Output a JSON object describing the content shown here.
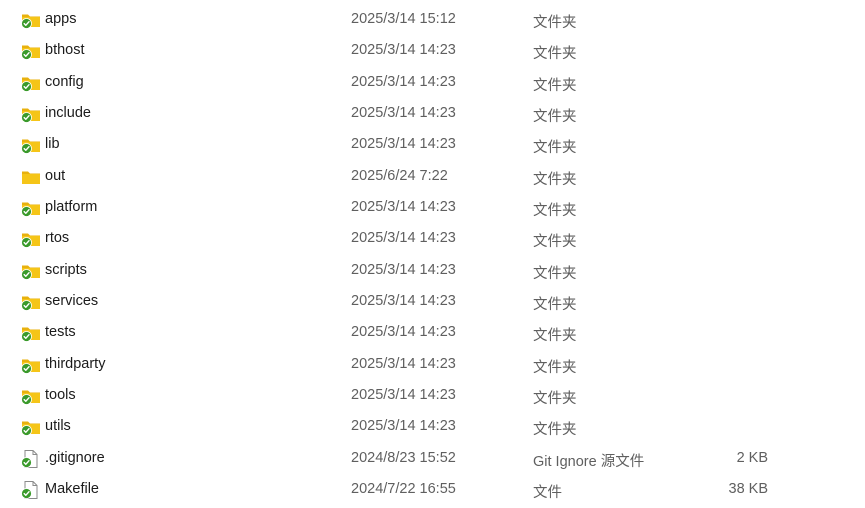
{
  "files": [
    {
      "name": "apps",
      "date": "2025/3/14 15:12",
      "type": "文件夹",
      "size": "",
      "icon": "folder-synced-icon"
    },
    {
      "name": "bthost",
      "date": "2025/3/14 14:23",
      "type": "文件夹",
      "size": "",
      "icon": "folder-synced-icon"
    },
    {
      "name": "config",
      "date": "2025/3/14 14:23",
      "type": "文件夹",
      "size": "",
      "icon": "folder-synced-icon"
    },
    {
      "name": "include",
      "date": "2025/3/14 14:23",
      "type": "文件夹",
      "size": "",
      "icon": "folder-synced-icon"
    },
    {
      "name": "lib",
      "date": "2025/3/14 14:23",
      "type": "文件夹",
      "size": "",
      "icon": "folder-synced-icon"
    },
    {
      "name": "out",
      "date": "2025/6/24 7:22",
      "type": "文件夹",
      "size": "",
      "icon": "folder-icon"
    },
    {
      "name": "platform",
      "date": "2025/3/14 14:23",
      "type": "文件夹",
      "size": "",
      "icon": "folder-synced-icon"
    },
    {
      "name": "rtos",
      "date": "2025/3/14 14:23",
      "type": "文件夹",
      "size": "",
      "icon": "folder-synced-icon"
    },
    {
      "name": "scripts",
      "date": "2025/3/14 14:23",
      "type": "文件夹",
      "size": "",
      "icon": "folder-synced-icon"
    },
    {
      "name": "services",
      "date": "2025/3/14 14:23",
      "type": "文件夹",
      "size": "",
      "icon": "folder-synced-icon"
    },
    {
      "name": "tests",
      "date": "2025/3/14 14:23",
      "type": "文件夹",
      "size": "",
      "icon": "folder-synced-icon"
    },
    {
      "name": "thirdparty",
      "date": "2025/3/14 14:23",
      "type": "文件夹",
      "size": "",
      "icon": "folder-synced-icon"
    },
    {
      "name": "tools",
      "date": "2025/3/14 14:23",
      "type": "文件夹",
      "size": "",
      "icon": "folder-synced-icon"
    },
    {
      "name": "utils",
      "date": "2025/3/14 14:23",
      "type": "文件夹",
      "size": "",
      "icon": "folder-synced-icon"
    },
    {
      "name": ".gitignore",
      "date": "2024/8/23 15:52",
      "type": "Git Ignore 源文件",
      "size": "2 KB",
      "icon": "file-synced-icon"
    },
    {
      "name": "Makefile",
      "date": "2024/7/22 16:55",
      "type": "文件",
      "size": "38 KB",
      "icon": "file-synced-icon"
    }
  ],
  "colors": {
    "folder": "#f5c518",
    "folder_back": "#e8b10e",
    "sync_badge": "#3a9a2b",
    "date_text": "#5f5f5f"
  }
}
